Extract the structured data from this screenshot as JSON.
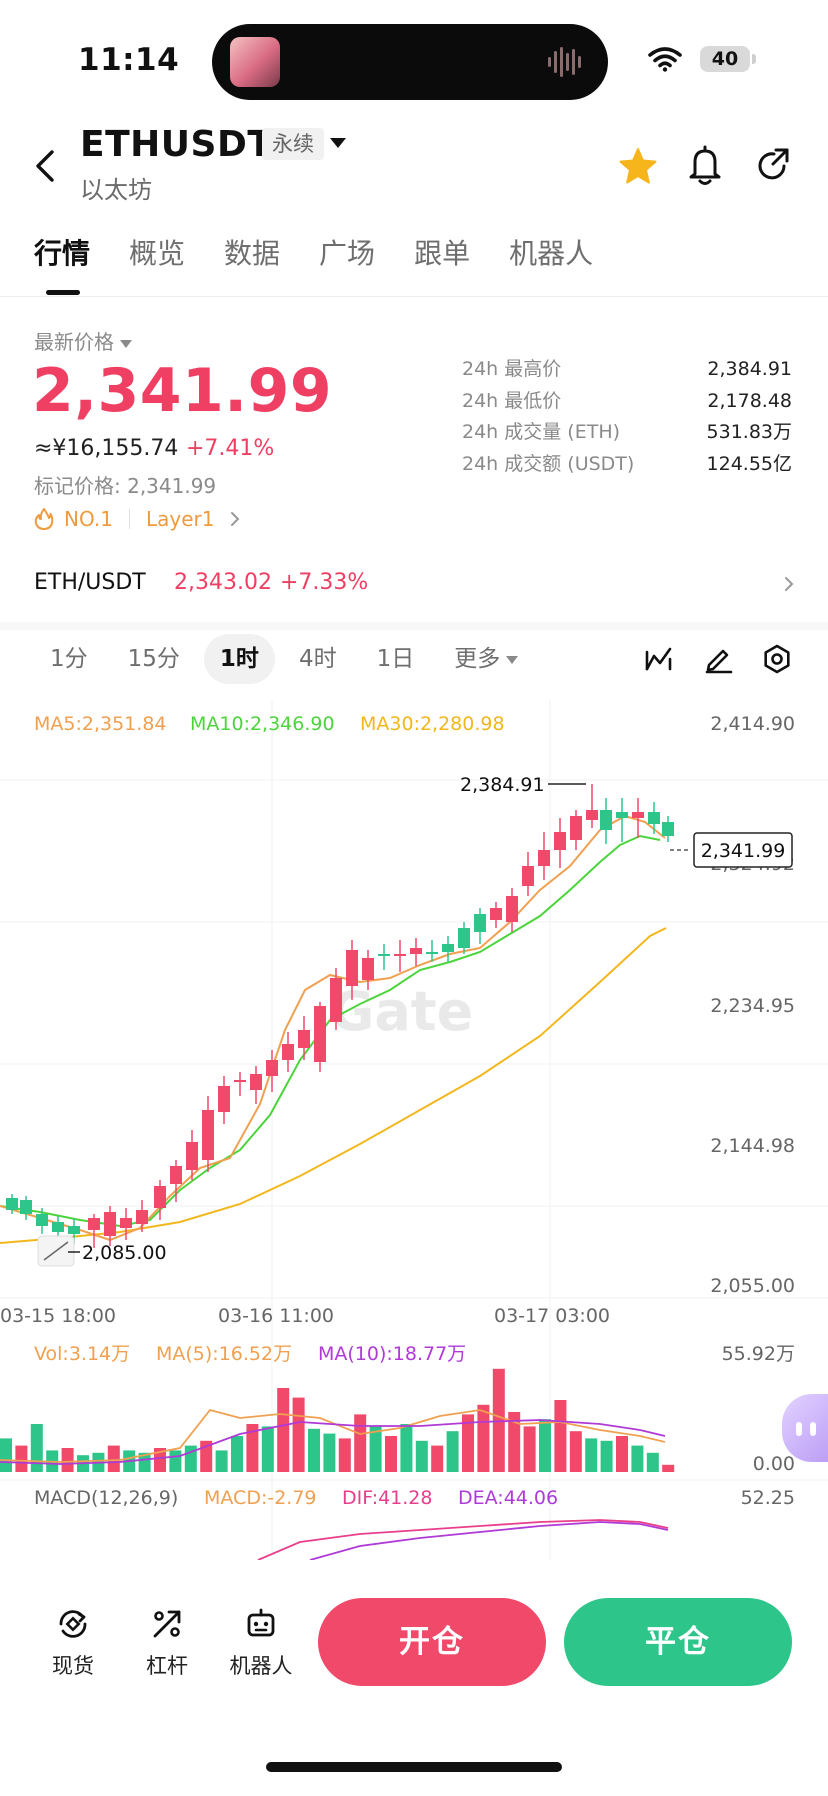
{
  "status_bar": {
    "time": "11:14",
    "battery": "40"
  },
  "header": {
    "pair": "ETHUSDT",
    "contract_type": "永续",
    "subtitle": "以太坊"
  },
  "tabs": [
    "行情",
    "概览",
    "数据",
    "广场",
    "跟单",
    "机器人"
  ],
  "price": {
    "label": "最新价格",
    "last": "2,341.99",
    "cny": "≈¥16,155.74",
    "change": "+7.41%",
    "mark_price": "标记价格: 2,341.99",
    "tags": [
      "NO.1",
      "Layer1"
    ]
  },
  "stats": [
    {
      "label": "24h 最高价",
      "value": "2,384.91"
    },
    {
      "label": "24h 最低价",
      "value": "2,178.48"
    },
    {
      "label": "24h 成交量 (ETH)",
      "value": "531.83万"
    },
    {
      "label": "24h 成交额 (USDT)",
      "value": "124.55亿"
    }
  ],
  "spot": {
    "pair": "ETH/USDT",
    "price": "2,343.02",
    "change": "+7.33%"
  },
  "intervals": {
    "items": [
      "1分",
      "15分",
      "1时",
      "4时",
      "1日"
    ],
    "more": "更多",
    "selected": "1时"
  },
  "ma_legend": {
    "ma5": "MA5:2,351.84",
    "ma10": "MA10:2,346.90",
    "ma30": "MA30:2,280.98"
  },
  "price_axis": [
    "2,414.90",
    "2,324.92",
    "2,234.95",
    "2,144.98",
    "2,055.00"
  ],
  "time_axis": [
    "03-15 18:00",
    "03-16 11:00",
    "03-17 03:00"
  ],
  "annotations": {
    "high": "2,384.91",
    "low": "2,085.00",
    "current": "2,341.99"
  },
  "volume_legend": {
    "vol": "Vol:3.14万",
    "ma5": "MA(5):16.52万",
    "ma10": "MA(10):18.77万",
    "axis_top": "55.92万",
    "axis_bottom": "0.00"
  },
  "macd_legend": {
    "title": "MACD(12,26,9)",
    "macd": "MACD:-2.79",
    "dif": "DIF:41.28",
    "dea": "DEA:44.06",
    "axis_top": "52.25"
  },
  "watermark": "Gate",
  "colors": {
    "up": "#f0496a",
    "down": "#2ec58a",
    "ma5": "#f0a050",
    "ma10": "#4cd43c",
    "ma30": "#f3b71e",
    "dif": "#e83e8c",
    "dea": "#b03ad8"
  },
  "bottom_nav": {
    "spot": "现货",
    "leverage": "杠杆",
    "bot": "机器人",
    "open": "开仓",
    "close": "平仓"
  }
}
